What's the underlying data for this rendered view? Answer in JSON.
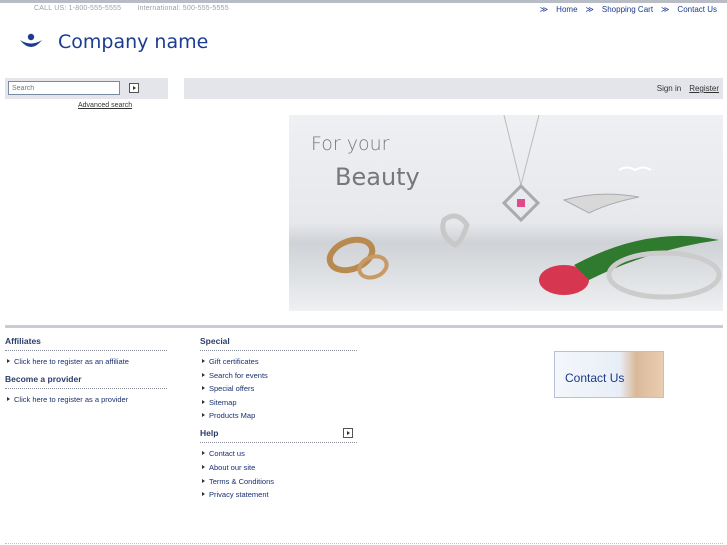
{
  "header": {
    "call_us": "CALL US: 1-800-555-5555",
    "international": "International: 500-555-5555",
    "nav": [
      "Home",
      "Shopping Cart",
      "Contact Us"
    ],
    "company_name": "Company name"
  },
  "search": {
    "placeholder": "Search",
    "advanced_label": "Advanced search"
  },
  "account": {
    "sign_in": "Sign in",
    "register": "Register"
  },
  "banner": {
    "line1": "For your",
    "line2": "Beauty"
  },
  "footer": {
    "affiliates_title": "Affiliates",
    "affiliates_items": [
      "Click here to register as an affiliate"
    ],
    "provider_title": "Become a provider",
    "provider_items": [
      "Click here to register as a provider"
    ],
    "special_title": "Special",
    "special_items": [
      "Gift certificates",
      "Search for events",
      "Special offers",
      "Sitemap",
      "Products Map"
    ],
    "help_title": "Help",
    "help_items": [
      "Contact us",
      "About our site",
      "Terms & Conditions",
      "Privacy statement"
    ],
    "contact_box": "Contact Us"
  },
  "colors": {
    "brand": "#1b3c91",
    "link": "#1a3070",
    "bar": "#e3e5ea"
  }
}
